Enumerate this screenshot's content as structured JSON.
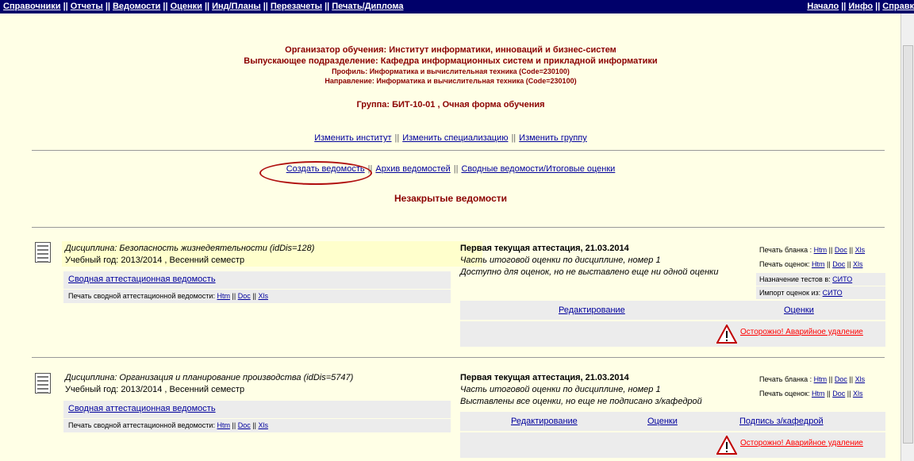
{
  "topnav": {
    "left": [
      "Справочники",
      "Отчеты",
      "Ведомости",
      "Оценки",
      "Инд/Планы",
      "Перезачеты",
      "Печать/Диплома"
    ],
    "right": [
      "Начало",
      "Инфо",
      "Справк"
    ],
    "sep": "||"
  },
  "header": {
    "organizer": "Организатор обучения: Институт информатики, инноваций и бизнес-систем",
    "department": "Выпускающее подразделение: Кафедра информационных систем и прикладной информатики",
    "profile": "Профиль: Информатика и вычислительная техника (Code=230100)",
    "direction": "Направление: Информатика и вычислительная техника (Code=230100)",
    "group": "Группа: БИТ-10-01 , Очная форма обучения"
  },
  "change_links": [
    "Изменить институт",
    "Изменить специализацию",
    "Изменить группу"
  ],
  "sheet_links": [
    "Создать ведомость",
    "Архив ведомостей",
    "Сводные ведомости/Итоговые оценки"
  ],
  "section_title": "Незакрытые ведомости",
  "labels": {
    "summary_sheet": "Сводная аттестационная ведомость",
    "print_summary": "Печать сводной аттестационной ведомости:",
    "print_blank": "Печать бланка :",
    "print_grades": "Печать оценок:",
    "assign_tests": "Назначение тестов в:",
    "import_grades": "Импорт оценок из:",
    "sito": "СИТО",
    "edit": "Редактирование",
    "grades": "Оценки",
    "dept_sign": "Подпись з/кафедрой",
    "warning": "Осторожно! Аварийное удаление",
    "htm": "Htm",
    "doc": "Doc",
    "xls": "Xls",
    "sep": "||"
  },
  "disciplines": [
    {
      "title": "Дисциплина: Безопасность жизнедеятельности (idDis=128)",
      "year": "Учебный год: 2013/2014 , Весенний семестр",
      "attestation": "Первая текущая аттестация, 21.03.2014",
      "part": "Часть итоговой оценки по дисциплине, номер 1",
      "status": "Доступно для оценок, но не выставлено еще ни одной оценки"
    },
    {
      "title": "Дисциплина: Организация и планирование производства (idDis=5747)",
      "year": "Учебный год: 2013/2014 , Весенний семестр",
      "attestation": "Первая текущая аттестация, 21.03.2014",
      "part": "Часть итоговой оценки по дисциплине, номер 1",
      "status": "Выставлены все оценки, но еще не подписано з/кафедрой"
    }
  ],
  "colors": {
    "topbar": "#00006a",
    "header_text": "#8b0000",
    "link": "#00009c",
    "warning": "#ff0000",
    "background": "#ffffe6",
    "highlight": "#ffffcc"
  }
}
